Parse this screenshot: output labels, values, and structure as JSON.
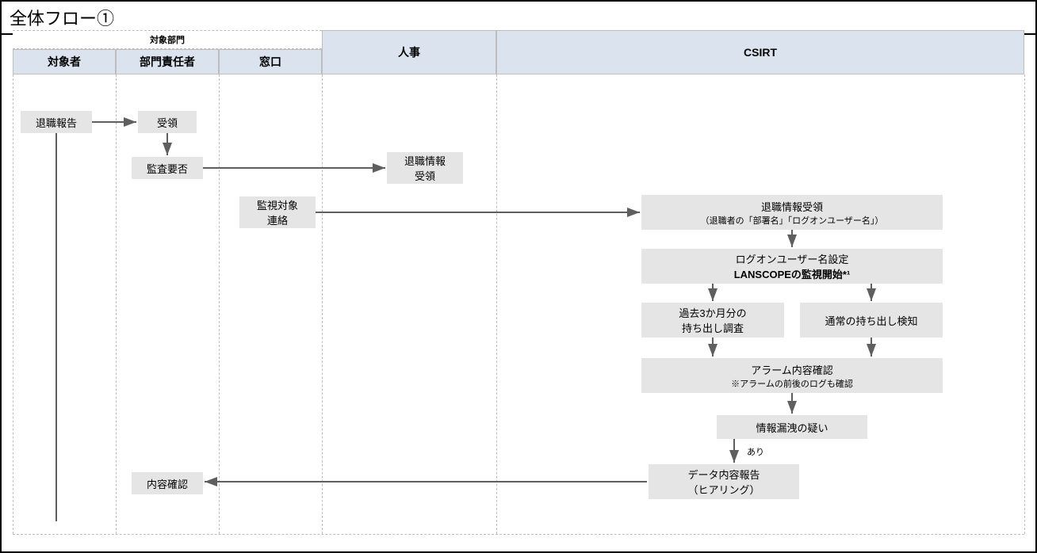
{
  "title": "全体フロー①",
  "lanes": {
    "group_label": "対象部門",
    "col1": "対象者",
    "col2": "部門責任者",
    "col3": "窓口",
    "col4": "人事",
    "col5": "CSIRT"
  },
  "nodes": {
    "n1": "退職報告",
    "n2": "受領",
    "n3": "監査要否",
    "n4": {
      "l1": "監視対象",
      "l2": "連絡"
    },
    "n5": {
      "l1": "退職情報",
      "l2": "受領"
    },
    "n6": {
      "l1": "退職情報受領",
      "l2": "（退職者の「部署名」「ログオンユーザー名」）"
    },
    "n7": {
      "l1": "ログオンユーザー名設定",
      "l2": "LANSCOPEの監視開始*¹"
    },
    "n8": {
      "l1": "過去3か月分の",
      "l2": "持ち出し調査"
    },
    "n9": "通常の持ち出し検知",
    "n10": {
      "l1": "アラーム内容確認",
      "l2": "※アラームの前後のログも確認"
    },
    "n11": "情報漏洩の疑い",
    "n12": {
      "l1": "データ内容報告",
      "l2": "（ヒアリング）"
    },
    "n13": "内容確認",
    "label_ari": "あり"
  }
}
